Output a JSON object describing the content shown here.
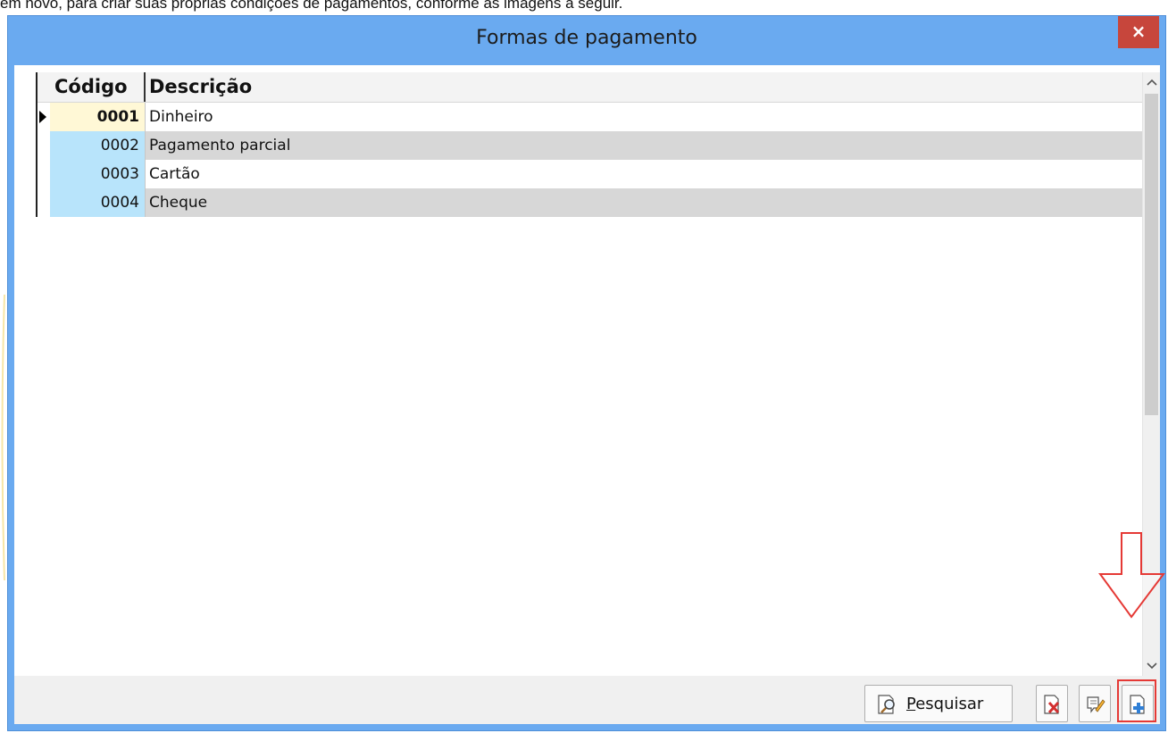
{
  "caption": "em novo, para criar suas próprias condições de pagamentos, conforme as imagens a seguir.",
  "window": {
    "title": "Formas de pagamento",
    "close_symbol": "×"
  },
  "grid": {
    "columns": [
      "Código",
      "Descrição"
    ],
    "rows": [
      {
        "code": "0001",
        "description": "Dinheiro",
        "selected": true
      },
      {
        "code": "0002",
        "description": "Pagamento parcial",
        "selected": false
      },
      {
        "code": "0003",
        "description": "Cartão",
        "selected": false
      },
      {
        "code": "0004",
        "description": "Cheque",
        "selected": false
      }
    ]
  },
  "toolbar": {
    "search_label_rest": "esquisar",
    "search_label_underlined": "P",
    "search_icon": "magnifier-icon",
    "delete_icon": "delete-record-icon",
    "edit_icon": "edit-record-icon",
    "add_icon": "add-record-icon"
  },
  "annotation": {
    "arrow_color": "#e53935",
    "highlight_target": "add-record-button"
  },
  "colors": {
    "title_bar": "#6aaaf0",
    "close_button": "#c7463c",
    "code_cell": "#b8e4fb",
    "selected_code_cell": "#fff8d6",
    "alt_row": "#d7d7d7"
  }
}
